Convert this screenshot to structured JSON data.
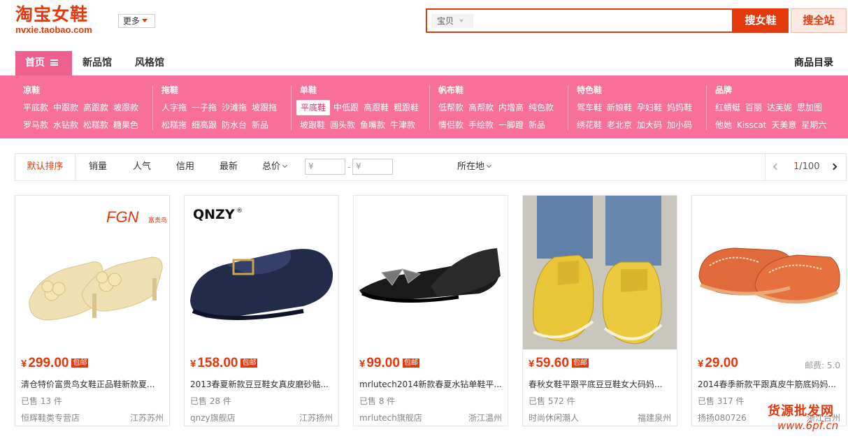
{
  "header": {
    "logo_title": "淘宝女鞋",
    "logo_domain": "nvxie.taobao.com",
    "more_label": "更多",
    "search_scope": "宝贝",
    "search_value": "",
    "btn_search_shoes": "搜女鞋",
    "btn_search_all": "搜全站",
    "accent_color": "#e4390d"
  },
  "nav": {
    "home": "首页",
    "new": "新品馆",
    "style": "风格馆",
    "catalog": "商品目录",
    "pink_color": "#f8709a"
  },
  "categories": [
    {
      "title": "凉鞋",
      "row1": [
        "平底款",
        "中跟款",
        "高跟款",
        "坡跟款"
      ],
      "row2": [
        "罗马款",
        "水钻款",
        "松糕款",
        "糖果色"
      ]
    },
    {
      "title": "拖鞋",
      "row1": [
        "人字拖",
        "一子拖",
        "沙滩拖",
        "坡跟拖"
      ],
      "row2": [
        "松糕拖",
        "细高跟",
        "防水台",
        "新品"
      ]
    },
    {
      "title": "单鞋",
      "row1": [
        "平底鞋",
        "中低跟",
        "高跟鞋",
        "粗跟鞋"
      ],
      "row2": [
        "坡跟鞋",
        "圆头款",
        "鱼嘴款",
        "牛津款"
      ]
    },
    {
      "title": "帆布鞋",
      "row1": [
        "低帮款",
        "高帮款",
        "内增高",
        "纯色款"
      ],
      "row2": [
        "情侣款",
        "手绘款",
        "一脚蹬",
        "新品"
      ]
    },
    {
      "title": "特色鞋",
      "row1": [
        "驾车鞋",
        "新娘鞋",
        "孕妇鞋",
        "妈妈鞋"
      ],
      "row2": [
        "绣花鞋",
        "老北京",
        "加大码",
        "加小码"
      ]
    },
    {
      "title": "品牌",
      "row1": [
        "红蜻蜓",
        "百丽",
        "达芙妮",
        "思加图"
      ],
      "row2": [
        "他她",
        "Kisscat",
        "天美意",
        "星期六"
      ]
    }
  ],
  "sortbar": {
    "default": "默认排序",
    "sales": "销量",
    "popular": "人气",
    "credit": "信用",
    "latest": "最新",
    "price": "总价",
    "price_min_placeholder": "¥",
    "price_sep": "-",
    "price_max_placeholder": "¥",
    "location": "所在地",
    "page_current": "1",
    "page_total": "/100"
  },
  "products": [
    {
      "price": "299.00",
      "free_ship": "包邮",
      "ship_fee": "",
      "title": "清仓特价富贵鸟女鞋正品鞋新款夏...",
      "sold": "已售 13 件",
      "shop": "恒辉鞋类专营店",
      "location": "江苏苏州",
      "brand_mark": "FGN"
    },
    {
      "price": "158.00",
      "free_ship": "包邮",
      "ship_fee": "",
      "title": "2013春夏新款豆豆鞋女真皮磨砂骷...",
      "sold": "已售 28 件",
      "shop": "qnzy旗舰店",
      "location": "江苏扬州",
      "brand_mark": "QNZY®"
    },
    {
      "price": "99.00",
      "free_ship": "包邮",
      "ship_fee": "",
      "title": "mrlutech2014新款春夏水钻单鞋平...",
      "sold": "已售 8 件",
      "shop": "mrlutech旗舰店",
      "location": "浙江温州",
      "brand_mark": ""
    },
    {
      "price": "59.60",
      "free_ship": "包邮",
      "ship_fee": "",
      "title": "春秋女鞋平跟平底豆豆鞋女大码妈...",
      "sold": "已售 572 件",
      "shop": "时尚休闲潮人",
      "location": "福建泉州",
      "brand_mark": ""
    },
    {
      "price": "29.00",
      "free_ship": "",
      "ship_fee": "邮费: 5.0",
      "title": "2014春季新款平跟真皮牛筋底妈妈...",
      "sold": "已售 317 件",
      "shop": "扬扬080726",
      "location": "浙江台州",
      "brand_mark": ""
    }
  ],
  "currency_symbol": "¥",
  "watermark": {
    "line1": "货源批发网",
    "line2": "www.6pf.cn"
  }
}
